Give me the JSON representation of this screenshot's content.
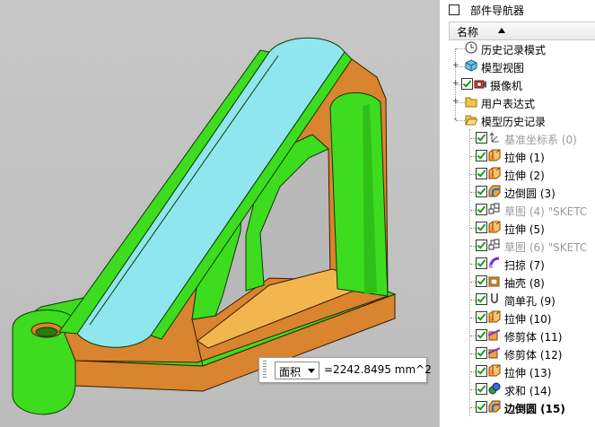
{
  "navigator": {
    "title": "部件导航器",
    "column_name": "名称",
    "items": [
      {
        "label": "历史记录模式",
        "icon": "clock-icon",
        "level": 1,
        "expander": "",
        "checked": false,
        "dim": false,
        "bold": false
      },
      {
        "label": "模型视图",
        "icon": "model-view-icon",
        "level": 1,
        "expander": "+",
        "checked": false,
        "dim": false,
        "bold": false
      },
      {
        "label": "摄像机",
        "icon": "camera-icon",
        "level": 1,
        "expander": "+",
        "checked": true,
        "dim": false,
        "bold": false
      },
      {
        "label": "用户表达式",
        "icon": "folder-icon",
        "level": 1,
        "expander": "+",
        "checked": false,
        "dim": false,
        "bold": false
      },
      {
        "label": "模型历史记录",
        "icon": "folder-open-icon",
        "level": 1,
        "expander": "-",
        "checked": false,
        "dim": false,
        "bold": false
      },
      {
        "label": "基准坐标系 (0)",
        "icon": "datum-csys-icon",
        "level": 2,
        "expander": "",
        "checked": true,
        "dim": true,
        "bold": false
      },
      {
        "label": "拉伸 (1)",
        "icon": "extrude-icon",
        "level": 2,
        "expander": "",
        "checked": true,
        "dim": false,
        "bold": false
      },
      {
        "label": "拉伸 (2)",
        "icon": "extrude-icon",
        "level": 2,
        "expander": "",
        "checked": true,
        "dim": false,
        "bold": false
      },
      {
        "label": "边倒圆 (3)",
        "icon": "edge-blend-icon",
        "level": 2,
        "expander": "",
        "checked": true,
        "dim": false,
        "bold": false
      },
      {
        "label": "草图 (4) \"SKETC",
        "icon": "sketch-icon",
        "level": 2,
        "expander": "",
        "checked": true,
        "dim": true,
        "bold": false
      },
      {
        "label": "拉伸 (5)",
        "icon": "extrude-icon",
        "level": 2,
        "expander": "",
        "checked": true,
        "dim": false,
        "bold": false
      },
      {
        "label": "草图 (6) \"SKETC",
        "icon": "sketch-icon",
        "level": 2,
        "expander": "",
        "checked": true,
        "dim": true,
        "bold": false
      },
      {
        "label": "扫掠 (7)",
        "icon": "sweep-icon",
        "level": 2,
        "expander": "",
        "checked": true,
        "dim": false,
        "bold": false
      },
      {
        "label": "抽壳 (8)",
        "icon": "shell-icon",
        "level": 2,
        "expander": "",
        "checked": true,
        "dim": false,
        "bold": false
      },
      {
        "label": "简单孔 (9)",
        "icon": "hole-icon",
        "level": 2,
        "expander": "",
        "checked": true,
        "dim": false,
        "bold": false
      },
      {
        "label": "拉伸 (10)",
        "icon": "extrude-icon",
        "level": 2,
        "expander": "",
        "checked": true,
        "dim": false,
        "bold": false
      },
      {
        "label": "修剪体 (11)",
        "icon": "trim-body-icon",
        "level": 2,
        "expander": "",
        "checked": true,
        "dim": false,
        "bold": false
      },
      {
        "label": "修剪体 (12)",
        "icon": "trim-body-icon",
        "level": 2,
        "expander": "",
        "checked": true,
        "dim": false,
        "bold": false
      },
      {
        "label": "拉伸 (13)",
        "icon": "extrude-icon",
        "level": 2,
        "expander": "",
        "checked": true,
        "dim": false,
        "bold": false
      },
      {
        "label": "求和 (14)",
        "icon": "unite-icon",
        "level": 2,
        "expander": "",
        "checked": true,
        "dim": false,
        "bold": false
      },
      {
        "label": "边倒圆 (15)",
        "icon": "edge-blend-icon",
        "level": 2,
        "expander": "",
        "checked": true,
        "dim": false,
        "bold": true
      }
    ]
  },
  "measure": {
    "type_option": "面积",
    "value": "=2242.8495 mm^2"
  },
  "colors": {
    "part_orange": "#d9842f",
    "part_green": "#3ddc1f",
    "part_cyan": "#8fe6ee",
    "inner_face": "#f3b64e",
    "viewport_bg": "#c3c3c3"
  }
}
